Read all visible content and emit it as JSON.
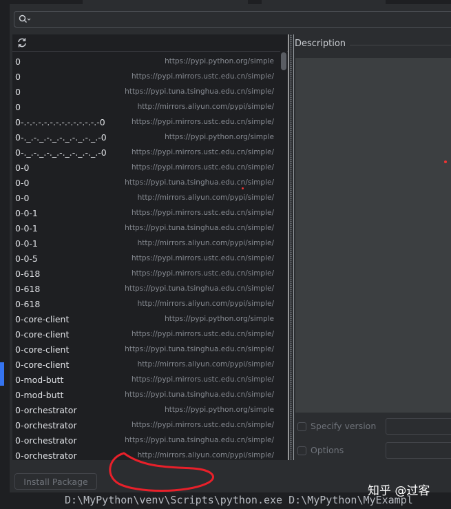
{
  "search": {
    "value": "",
    "placeholder": ""
  },
  "packages": [
    {
      "name": "0",
      "repo": "https://pypi.python.org/simple"
    },
    {
      "name": "0",
      "repo": "https://pypi.mirrors.ustc.edu.cn/simple/"
    },
    {
      "name": "0",
      "repo": "https://pypi.tuna.tsinghua.edu.cn/simple/"
    },
    {
      "name": "0",
      "repo": "http://mirrors.aliyun.com/pypi/simple/"
    },
    {
      "name": "0-.-.-.-.-.-.-.-.-.-.-.-.-.-0",
      "repo": "https://pypi.mirrors.ustc.edu.cn/simple/"
    },
    {
      "name": "0-._.-._.-._.-._.-._.-._.-0",
      "repo": "https://pypi.python.org/simple"
    },
    {
      "name": "0-._.-._.-._.-._.-._.-._.-0",
      "repo": "https://pypi.mirrors.ustc.edu.cn/simple/"
    },
    {
      "name": "0-0",
      "repo": "https://pypi.mirrors.ustc.edu.cn/simple/"
    },
    {
      "name": "0-0",
      "repo": "https://pypi.tuna.tsinghua.edu.cn/simple/"
    },
    {
      "name": "0-0",
      "repo": "http://mirrors.aliyun.com/pypi/simple/"
    },
    {
      "name": "0-0-1",
      "repo": "https://pypi.mirrors.ustc.edu.cn/simple/"
    },
    {
      "name": "0-0-1",
      "repo": "https://pypi.tuna.tsinghua.edu.cn/simple/"
    },
    {
      "name": "0-0-1",
      "repo": "http://mirrors.aliyun.com/pypi/simple/"
    },
    {
      "name": "0-0-5",
      "repo": "https://pypi.mirrors.ustc.edu.cn/simple/"
    },
    {
      "name": "0-618",
      "repo": "https://pypi.mirrors.ustc.edu.cn/simple/"
    },
    {
      "name": "0-618",
      "repo": "https://pypi.tuna.tsinghua.edu.cn/simple/"
    },
    {
      "name": "0-618",
      "repo": "http://mirrors.aliyun.com/pypi/simple/"
    },
    {
      "name": "0-core-client",
      "repo": "https://pypi.python.org/simple"
    },
    {
      "name": "0-core-client",
      "repo": "https://pypi.mirrors.ustc.edu.cn/simple/"
    },
    {
      "name": "0-core-client",
      "repo": "https://pypi.tuna.tsinghua.edu.cn/simple/"
    },
    {
      "name": "0-core-client",
      "repo": "http://mirrors.aliyun.com/pypi/simple/"
    },
    {
      "name": "0-mod-butt",
      "repo": "https://pypi.mirrors.ustc.edu.cn/simple/"
    },
    {
      "name": "0-mod-butt",
      "repo": "https://pypi.tuna.tsinghua.edu.cn/simple/"
    },
    {
      "name": "0-orchestrator",
      "repo": "https://pypi.python.org/simple"
    },
    {
      "name": "0-orchestrator",
      "repo": "https://pypi.mirrors.ustc.edu.cn/simple/"
    },
    {
      "name": "0-orchestrator",
      "repo": "https://pypi.tuna.tsinghua.edu.cn/simple/"
    },
    {
      "name": "0-orchestrator",
      "repo": "http://mirrors.aliyun.com/pypi/simple/"
    }
  ],
  "description": {
    "label": "Description"
  },
  "options": {
    "specify_version_label": "Specify version",
    "options_label": "Options"
  },
  "install_button": {
    "label": "Install Package"
  },
  "console": {
    "text": "D:\\MyPython\\venv\\Scripts\\python.exe D:\\MyPython\\MyExampl"
  },
  "watermark": {
    "text": "知乎 @过客"
  },
  "icons": {
    "search": "search-icon",
    "refresh": "refresh-icon"
  },
  "colors": {
    "accent": "#3574f0",
    "annotation": "#e8202a",
    "panel_bg": "#2b2d30",
    "list_bg": "#1e1f22"
  }
}
